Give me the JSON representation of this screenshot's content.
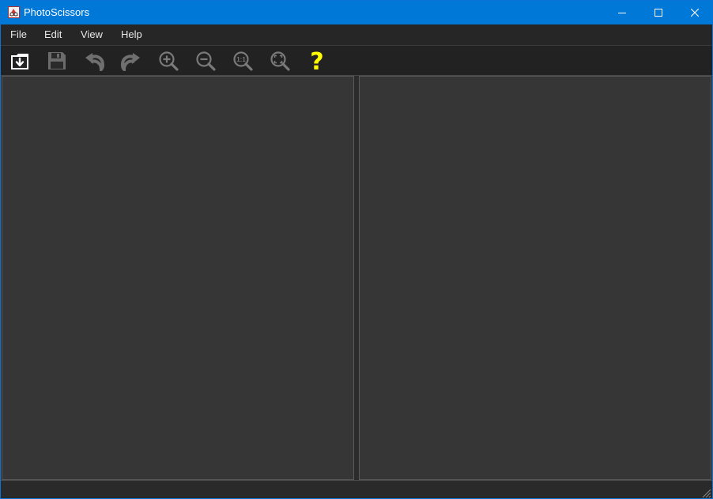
{
  "window": {
    "title": "PhotoScissors"
  },
  "title_buttons": {
    "minimize": "—",
    "maximize": "☐",
    "close": "✕"
  },
  "menu": {
    "items": [
      "File",
      "Edit",
      "View",
      "Help"
    ]
  },
  "toolbar": {
    "icons": [
      "open-icon",
      "save-icon",
      "undo-icon",
      "redo-icon",
      "zoom-in-icon",
      "zoom-out-icon",
      "actual-size-icon",
      "fit-to-window-icon",
      "help-icon"
    ],
    "zoom_actual_label": "1:1",
    "help_label": "?",
    "help_color": "#ffff00"
  },
  "colors": {
    "titlebar": "#0078d7",
    "background": "#363636",
    "toolbar": "#222222"
  }
}
